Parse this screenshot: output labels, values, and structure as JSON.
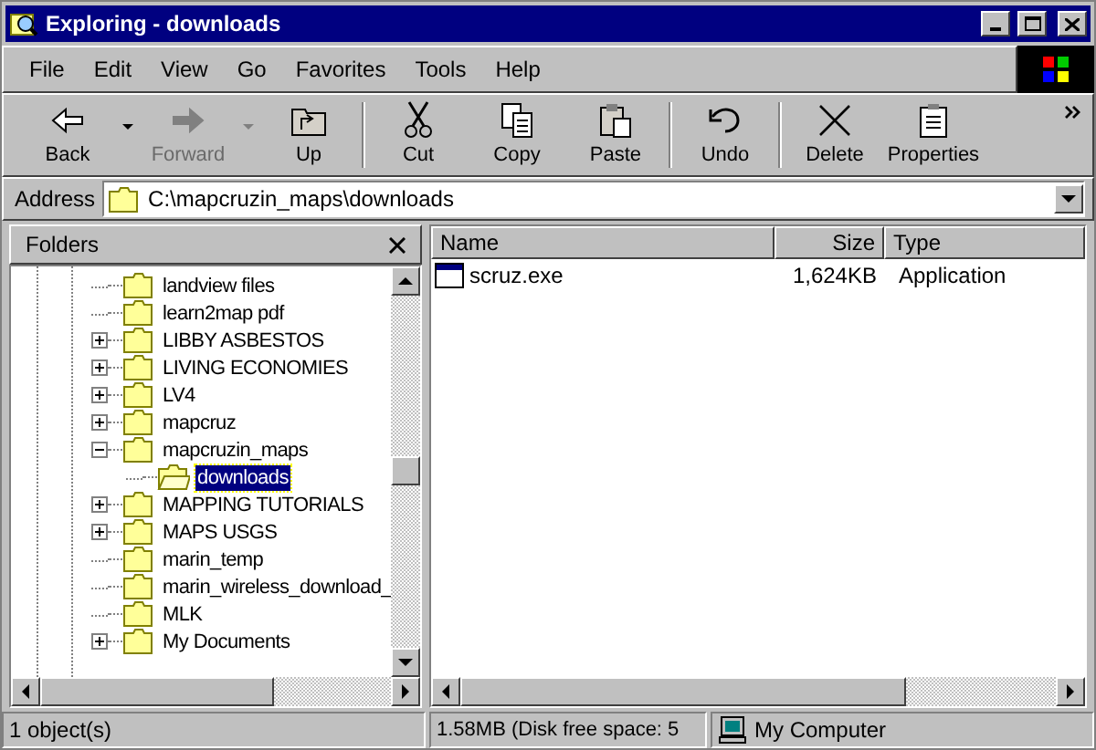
{
  "window": {
    "title": "Exploring - downloads"
  },
  "menu": [
    "File",
    "Edit",
    "View",
    "Go",
    "Favorites",
    "Tools",
    "Help"
  ],
  "toolbar": [
    {
      "label": "Back",
      "disabled": false,
      "dropdown": true,
      "separator_before": false
    },
    {
      "label": "Forward",
      "disabled": true,
      "dropdown": true,
      "separator_before": false
    },
    {
      "label": "Up",
      "disabled": false,
      "dropdown": false,
      "separator_before": false
    },
    {
      "label": "Cut",
      "disabled": false,
      "dropdown": false,
      "separator_before": true
    },
    {
      "label": "Copy",
      "disabled": false,
      "dropdown": false,
      "separator_before": false
    },
    {
      "label": "Paste",
      "disabled": false,
      "dropdown": false,
      "separator_before": false
    },
    {
      "label": "Undo",
      "disabled": false,
      "dropdown": false,
      "separator_before": true
    },
    {
      "label": "Delete",
      "disabled": false,
      "dropdown": false,
      "separator_before": true
    },
    {
      "label": "Properties",
      "disabled": false,
      "dropdown": false,
      "separator_before": false
    }
  ],
  "address": {
    "label": "Address",
    "value": "C:\\mapcruzin_maps\\downloads"
  },
  "folders": {
    "title": "Folders",
    "items": [
      {
        "label": "landview files",
        "kind": "leaf",
        "selected": false
      },
      {
        "label": "learn2map pdf",
        "kind": "leaf",
        "selected": false
      },
      {
        "label": "LIBBY ASBESTOS",
        "kind": "collapsed",
        "selected": false
      },
      {
        "label": "LIVING ECONOMIES",
        "kind": "collapsed",
        "selected": false
      },
      {
        "label": "LV4",
        "kind": "collapsed",
        "selected": false
      },
      {
        "label": "mapcruz",
        "kind": "collapsed",
        "selected": false
      },
      {
        "label": "mapcruzin_maps",
        "kind": "expanded",
        "selected": false,
        "children": [
          {
            "label": "downloads",
            "kind": "leaf",
            "selected": true
          }
        ]
      },
      {
        "label": "MAPPING TUTORIALS",
        "kind": "collapsed",
        "selected": false
      },
      {
        "label": "MAPS USGS",
        "kind": "collapsed",
        "selected": false
      },
      {
        "label": "marin_temp",
        "kind": "leaf",
        "selected": false
      },
      {
        "label": "marin_wireless_download_",
        "kind": "leaf",
        "selected": false
      },
      {
        "label": "MLK",
        "kind": "leaf",
        "selected": false
      },
      {
        "label": "My Documents",
        "kind": "collapsed",
        "selected": false
      }
    ]
  },
  "files": {
    "columns": [
      "Name",
      "Size",
      "Type"
    ],
    "rows": [
      {
        "name": "scruz.exe",
        "size": "1,624KB",
        "type": "Application"
      }
    ]
  },
  "status_bar": [
    "1 object(s)",
    "1.58MB (Disk free space: 5",
    "My Computer"
  ]
}
